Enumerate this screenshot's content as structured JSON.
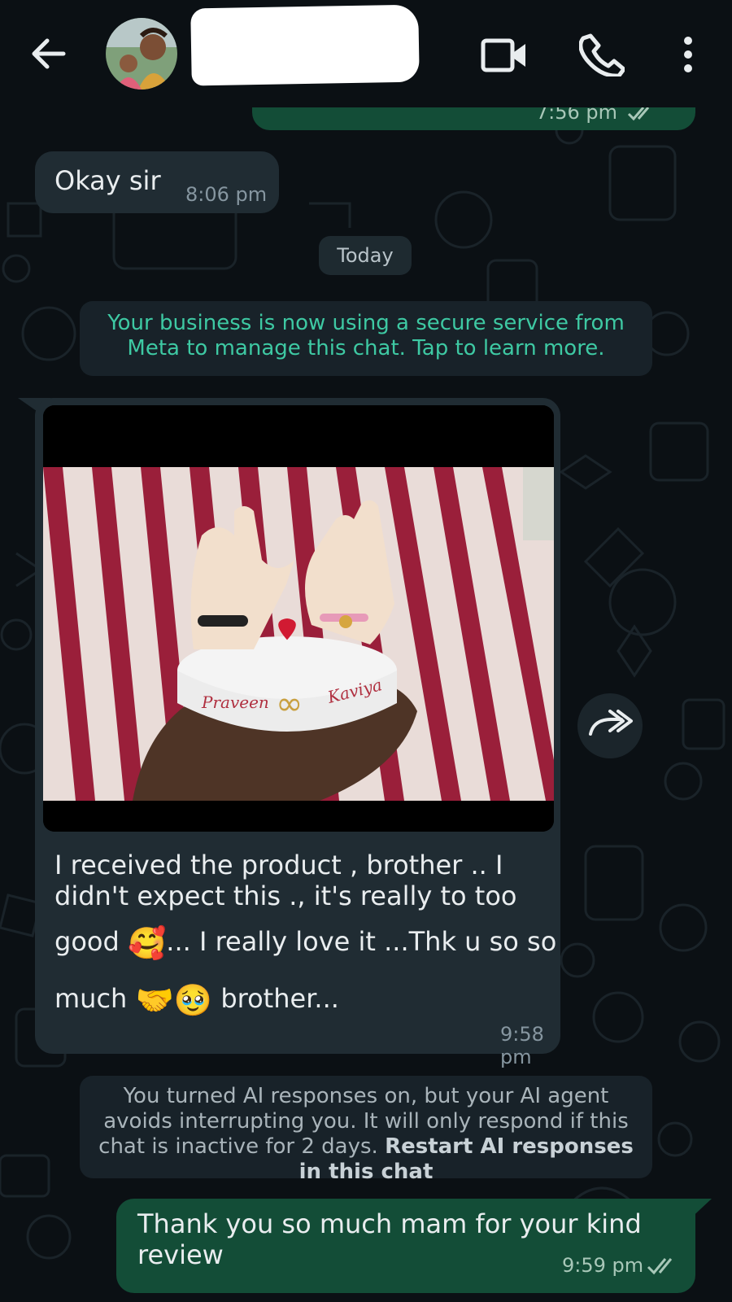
{
  "header": {
    "avatar_alt": "contact avatar",
    "contact_name": ""
  },
  "messages": {
    "previous_outgoing_time": "7:56 pm",
    "okay": {
      "text": "Okay sir",
      "time": "8:06 pm"
    },
    "date_chip": "Today",
    "secure_notice": "Your business is now using a secure service from Meta to manage this chat. Tap to learn more.",
    "review": {
      "line1": "I received the product , brother .. I",
      "line2": "didn't expect this ., it's really to too",
      "line3_a": "good",
      "line3_emoji": "🥰",
      "line3_b": "... I really love it ...Thk u so so",
      "line4_a": "much",
      "line4_emoji1": "🤝",
      "line4_emoji2": "🥹",
      "line4_b": "brother...",
      "time": "9:58 pm",
      "photo": {
        "name_left": "Praveen",
        "name_right": "Kaviya",
        "symbol": "∞"
      }
    },
    "ai_notice": {
      "text": "You turned AI responses on, but your AI agent avoids interrupting you. It will only respond if this chat is inactive for 2 days.",
      "link": "Restart AI responses in this chat"
    },
    "reply": {
      "text": "Thank you so much mam for your kind review",
      "time": "9:59 pm"
    }
  },
  "colors": {
    "background": "#0b1014",
    "incoming_bubble": "#202c33",
    "outgoing_bubble": "#134d37",
    "accent_teal": "#3ec9a3"
  },
  "icons": [
    "back-arrow-icon",
    "video-call-icon",
    "phone-icon",
    "more-options-icon",
    "forward-icon",
    "double-check-icon"
  ]
}
